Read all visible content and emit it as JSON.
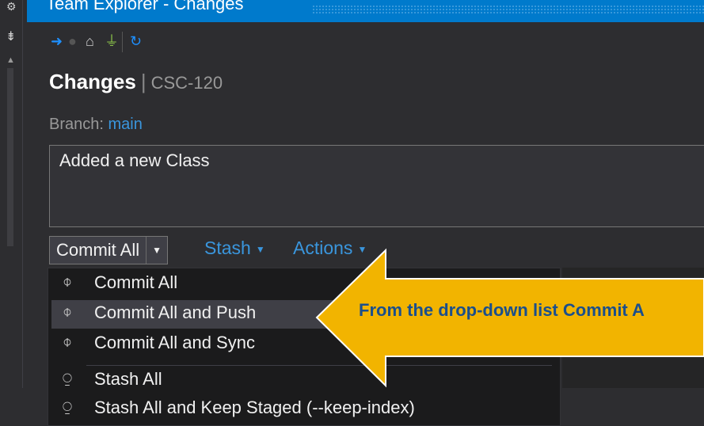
{
  "window": {
    "title": "Team Explorer - Changes"
  },
  "page": {
    "heading": "Changes",
    "separator": "|",
    "project": "CSC-120"
  },
  "branch": {
    "label": "Branch:",
    "value": "main"
  },
  "commit_message": {
    "value": "Added a new Class"
  },
  "buttons": {
    "commit_all": "Commit All",
    "stash": "Stash",
    "actions": "Actions"
  },
  "dropdown": {
    "items": [
      {
        "label": "Commit All",
        "icon": "commit-icon"
      },
      {
        "label": "Commit All and Push",
        "icon": "commit-icon",
        "highlighted": true
      },
      {
        "label": "Commit All and Sync",
        "icon": "commit-icon"
      },
      {
        "label": "Stash All",
        "icon": "stash-icon"
      },
      {
        "label": "Stash All and Keep Staged (--keep-index)",
        "icon": "stash-icon"
      }
    ]
  },
  "annotation": {
    "text": "From the drop-down list Commit A",
    "arrow_color": "#f2b400",
    "text_color": "#1b4f8c"
  },
  "colors": {
    "accent": "#007acc",
    "link": "#3a96dd",
    "background": "#2d2d30"
  }
}
